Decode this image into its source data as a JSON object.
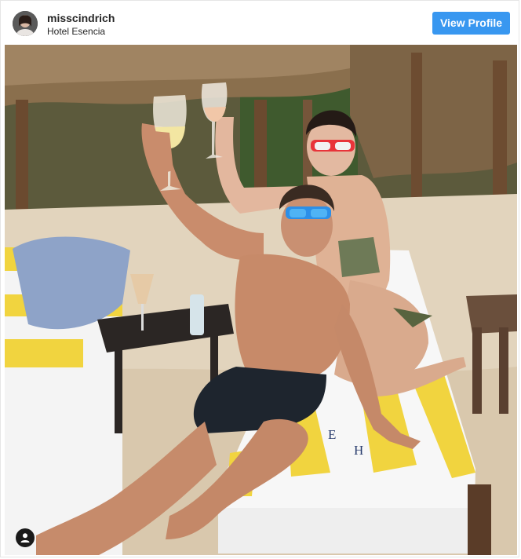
{
  "post": {
    "username": "misscindrich",
    "location": "Hotel Esencia",
    "view_profile_label": "View Profile",
    "colors": {
      "button": "#3897f0",
      "text": "#262626",
      "towel_stripe": "#f2d33a"
    }
  },
  "photo": {
    "towel_letters": [
      "E",
      "H"
    ],
    "icons": {
      "tag": "person-tag-icon"
    }
  }
}
